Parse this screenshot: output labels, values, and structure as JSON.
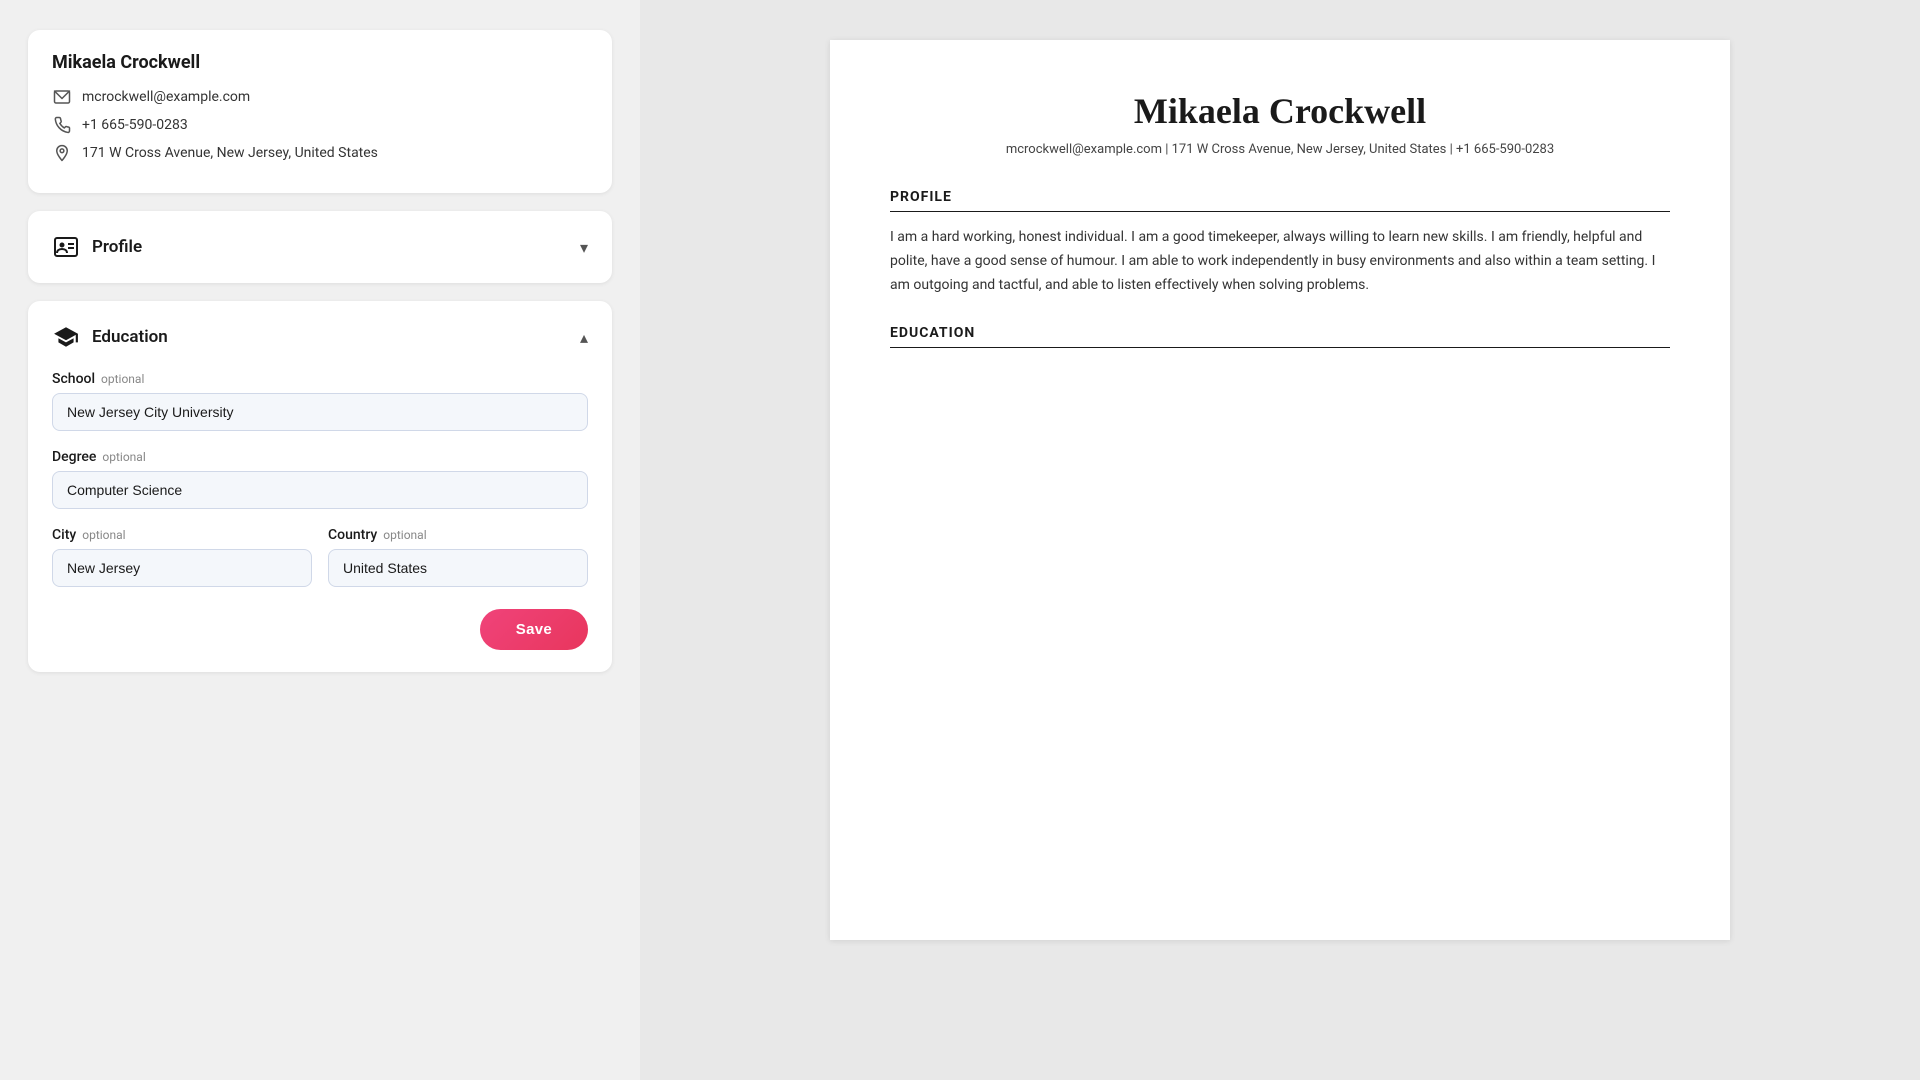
{
  "contact": {
    "name": "Mikaela Crockwell",
    "email": "mcrockwell@example.com",
    "phone": "+1 665-590-0283",
    "address": "171 W Cross Avenue, New Jersey, United States"
  },
  "profile_section": {
    "title": "Profile",
    "collapsed": true,
    "chevron": "▾"
  },
  "education_section": {
    "title": "Education",
    "collapsed": false,
    "chevron": "▴",
    "school_label": "School",
    "school_optional": "optional",
    "school_value": "New Jersey City University",
    "degree_label": "Degree",
    "degree_optional": "optional",
    "degree_value": "Computer Science",
    "city_label": "City",
    "city_optional": "optional",
    "city_value": "New Jersey",
    "country_label": "Country",
    "country_optional": "optional",
    "country_value": "United States",
    "save_label": "Save"
  },
  "resume": {
    "name": "Mikaela Crockwell",
    "contact_line": "mcrockwell@example.com | 171 W Cross Avenue, New Jersey, United States | +1 665-590-0283",
    "profile_section_title": "PROFILE",
    "profile_text": "I am a hard working, honest individual. I am a good timekeeper, always willing to learn new skills. I am friendly, helpful and polite, have a good sense of humour. I am able to work independently in busy environments and also within a team setting. I am outgoing and tactful, and able to listen effectively when solving problems.",
    "education_section_title": "EDUCATION"
  }
}
